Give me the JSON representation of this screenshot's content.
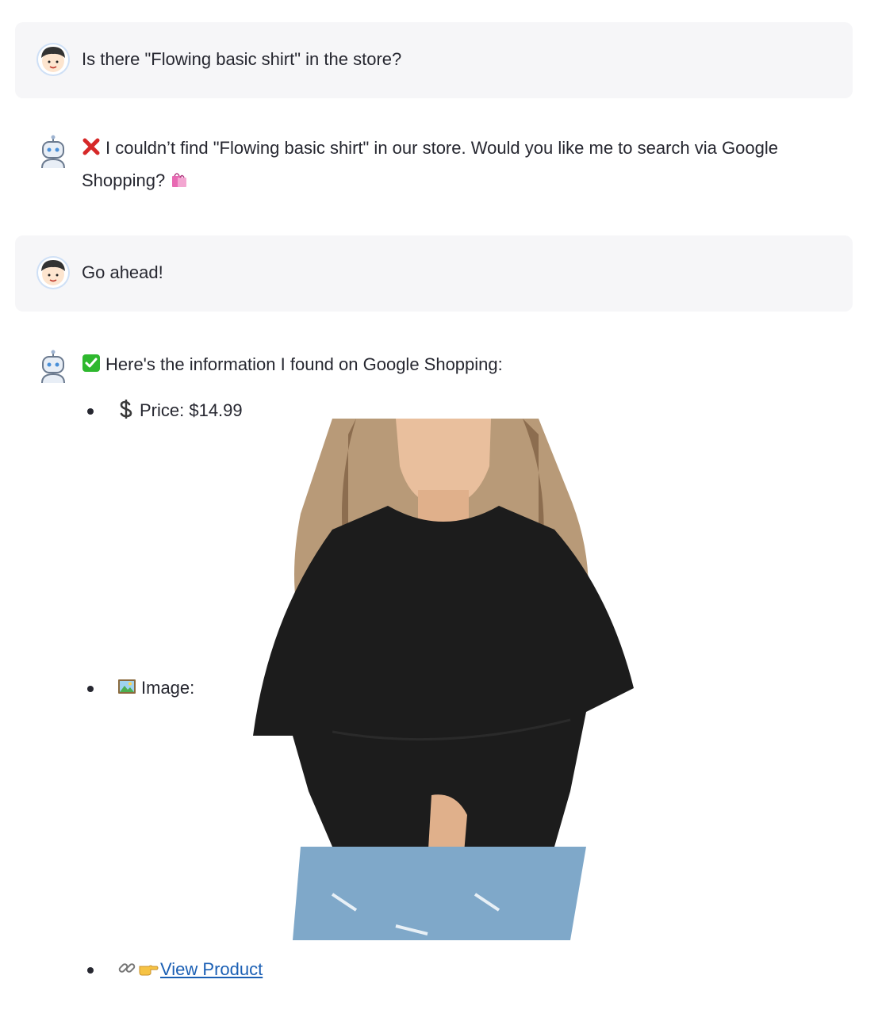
{
  "messages": [
    {
      "role": "user",
      "avatar": "user-avatar-icon",
      "text": "Is there \"Flowing basic shirt\" in the store?"
    },
    {
      "role": "assistant",
      "avatar": "robot-avatar-icon",
      "prefix_icon": "red-cross-mark-icon",
      "text": "I couldn’t find \"Flowing basic shirt\" in our store. Would you like me to search via Google Shopping?",
      "suffix_icon": "shopping-bags-icon"
    },
    {
      "role": "user",
      "avatar": "user-avatar-icon",
      "text": "Go ahead!"
    },
    {
      "role": "assistant",
      "avatar": "robot-avatar-icon",
      "prefix_icon": "green-check-mark-icon",
      "text": "Here's the information I found on Google Shopping:",
      "details": {
        "price_label": "Price: $14.99",
        "price_icon": "dollar-sign-icon",
        "image_label": "Image:",
        "image_icon": "framed-picture-icon",
        "image_alt": "product-photo",
        "link_icon": "link-icon",
        "pointer_icon": "pointing-right-hand-icon",
        "link_label": "View Product"
      }
    }
  ],
  "colors": {
    "user_bubble": "#f6f6f8",
    "text": "#262730",
    "link": "#1a5fb4",
    "cross": "#d62828",
    "check": "#2eb82e"
  }
}
